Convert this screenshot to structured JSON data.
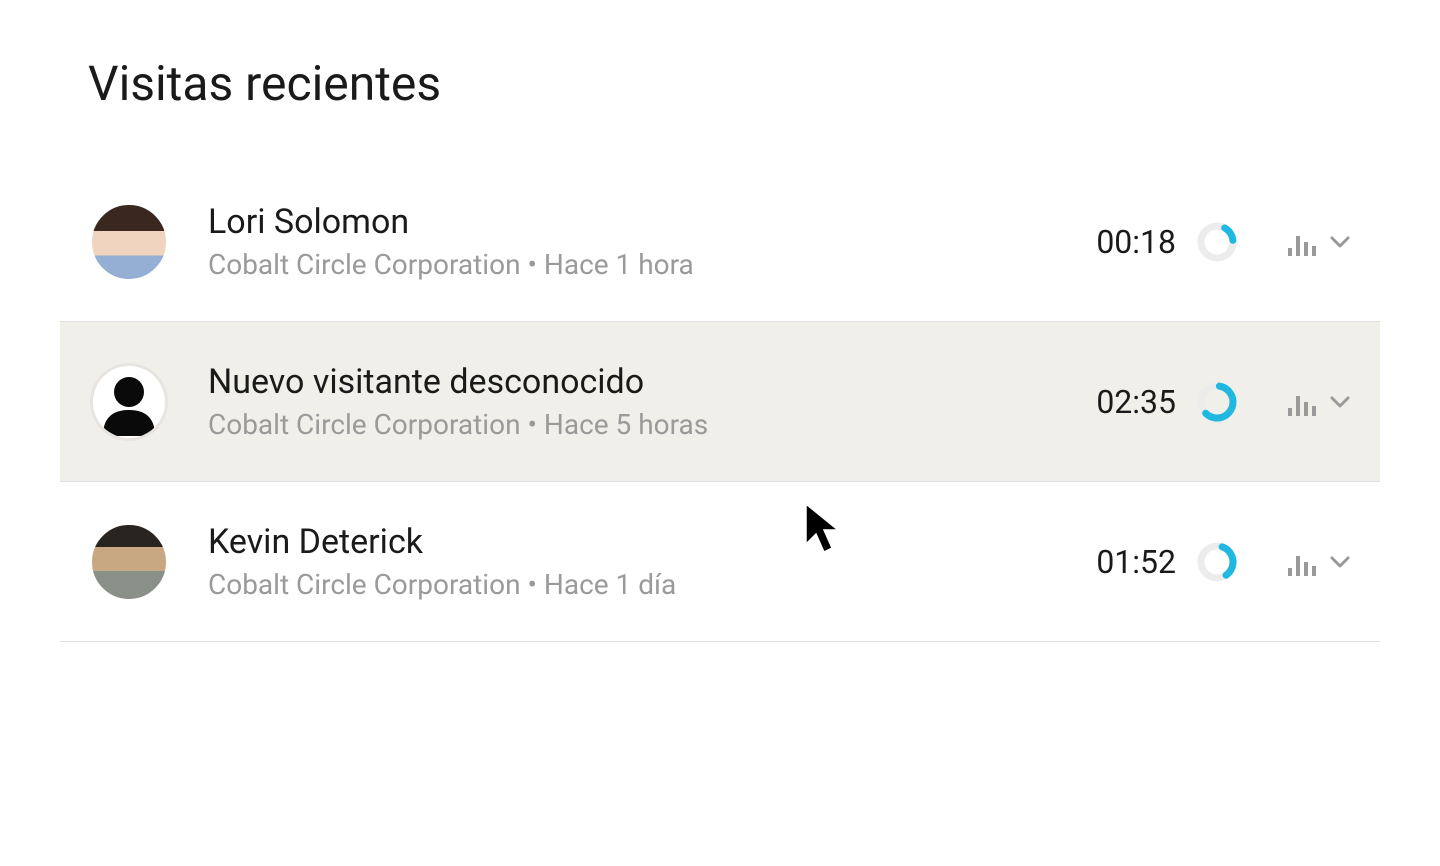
{
  "header": {
    "title": "Visitas recientes"
  },
  "visits": [
    {
      "name": "Lori Solomon",
      "company": "Cobalt Circle Corporation",
      "time_ago": "Hace 1 hora",
      "duration": "00:18",
      "progress_percent": 15,
      "avatar_type": "photo-1",
      "highlighted": false
    },
    {
      "name": "Nuevo visitante desconocido",
      "company": "Cobalt Circle Corporation",
      "time_ago": "Hace 5 horas",
      "duration": "02:35",
      "progress_percent": 60,
      "avatar_type": "anonymous",
      "highlighted": true
    },
    {
      "name": "Kevin Deterick",
      "company": "Cobalt Circle Corporation",
      "time_ago": "Hace 1 día",
      "duration": "01:52",
      "progress_percent": 35,
      "avatar_type": "photo-2",
      "highlighted": false
    }
  ],
  "colors": {
    "accent": "#20b8e0",
    "ring_bg": "#ececec",
    "icon_gray": "#9a9a9a"
  }
}
